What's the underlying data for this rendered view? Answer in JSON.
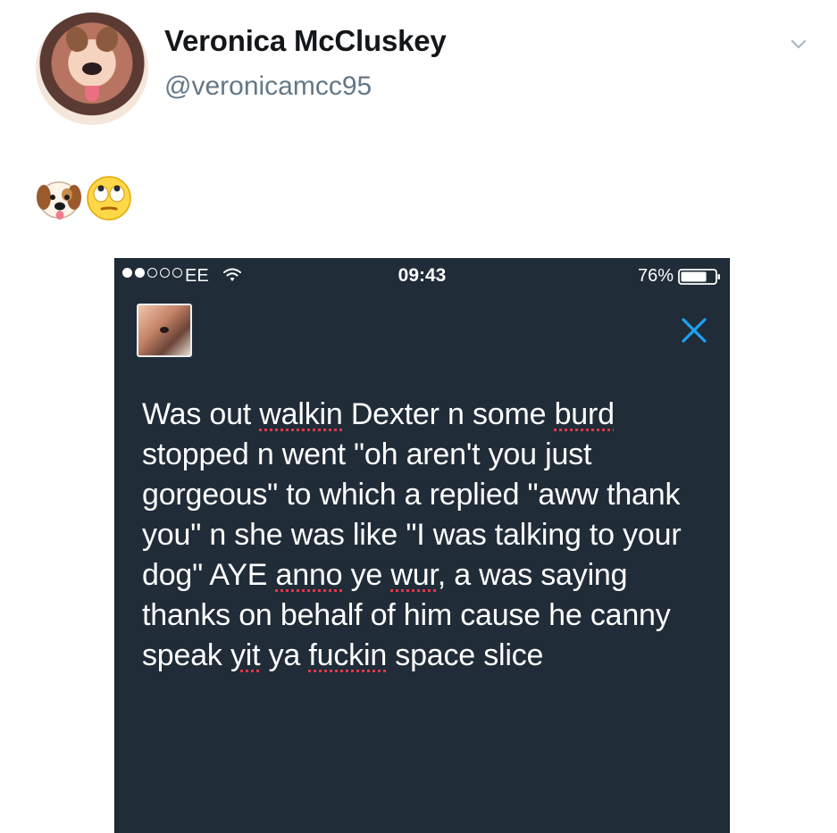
{
  "tweet": {
    "author_name": "Veronica McCluskey",
    "author_handle": "@veronicamcc95",
    "menu_icon": "chevron-down-icon",
    "emojis": [
      "dog-face-emoji",
      "face-with-rolling-eyes-emoji"
    ]
  },
  "screenshot": {
    "status_bar": {
      "signal_bars": 5,
      "signal_filled": 2,
      "carrier": "EE",
      "time": "09:43",
      "battery_percent": "76%",
      "battery_level": 0.76
    },
    "close_icon": "close-icon",
    "text_segments": [
      {
        "text": "Was out "
      },
      {
        "text": "walkin",
        "misspelled": true
      },
      {
        "text": " Dexter n some "
      },
      {
        "text": "burd",
        "misspelled": true
      },
      {
        "text": " stopped n went \"oh aren't you just gorgeous\" to which a replied \"aww thank you\" n she was like \"I was talking to your dog\" AYE "
      },
      {
        "text": "anno",
        "misspelled": true
      },
      {
        "text": " ye "
      },
      {
        "text": "wur",
        "misspelled": true
      },
      {
        "text": ", a was saying thanks on behalf of him cause he canny speak "
      },
      {
        "text": "yit",
        "misspelled": true
      },
      {
        "text": " ya "
      },
      {
        "text": "fuckin",
        "misspelled": true
      },
      {
        "text": " space slice"
      }
    ]
  },
  "colors": {
    "background": "#ffffff",
    "screenshot_background": "#202c38",
    "text_primary": "#14171a",
    "text_secondary": "#657786",
    "accent": "#1da1f2",
    "spellcheck": "#e3364a"
  }
}
